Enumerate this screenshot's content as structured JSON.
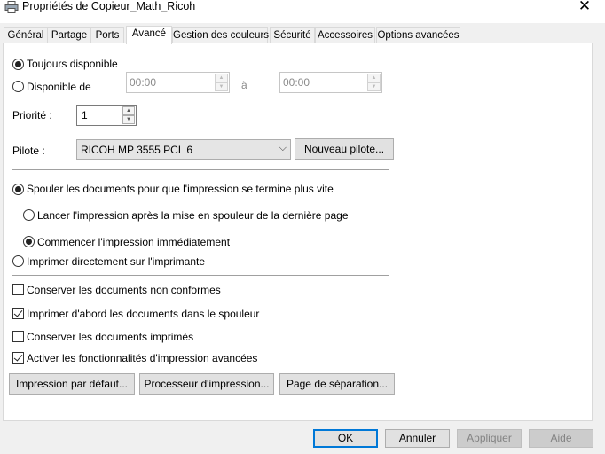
{
  "window": {
    "title": "Propriétés de Copieur_Math_Ricoh",
    "close_glyph": "✕"
  },
  "tabs": [
    {
      "label": "Général"
    },
    {
      "label": "Partage"
    },
    {
      "label": "Ports"
    },
    {
      "label": "Avancé",
      "active": true
    },
    {
      "label": "Gestion des couleurs"
    },
    {
      "label": "Sécurité"
    },
    {
      "label": "Accessoires"
    },
    {
      "label": "Options avancées"
    }
  ],
  "availability": {
    "always_label": "Toujours disponible",
    "always_checked": true,
    "from_label": "Disponible de",
    "from_time": "00:00",
    "to_label": "à",
    "to_time": "00:00"
  },
  "priority": {
    "label": "Priorité :",
    "value": "1"
  },
  "driver": {
    "label": "Pilote :",
    "selected": "RICOH MP 3555 PCL 6",
    "new_button": "Nouveau pilote..."
  },
  "spooling": {
    "spool_label": "Spouler les documents pour que l'impression se termine plus vite",
    "spool_checked": true,
    "after_last_page_label": "Lancer l'impression après la mise en spouleur de la dernière page",
    "after_last_page_checked": false,
    "immediately_label": "Commencer l'impression immédiatement",
    "immediately_checked": true,
    "direct_label": "Imprimer directement sur l'imprimante",
    "direct_checked": false
  },
  "options": [
    {
      "label": "Conserver les documents non conformes",
      "checked": false
    },
    {
      "label": "Imprimer d'abord les documents dans le spouleur",
      "checked": true
    },
    {
      "label": "Conserver les documents imprimés",
      "checked": false
    },
    {
      "label": "Activer les fonctionnalités d'impression avancées",
      "checked": true
    }
  ],
  "bottom_buttons": {
    "defaults": "Impression par défaut...",
    "processor": "Processeur d'impression...",
    "separator_page": "Page de séparation..."
  },
  "dialog_buttons": {
    "ok": "OK",
    "cancel": "Annuler",
    "apply": "Appliquer",
    "help": "Aide"
  },
  "colors": {
    "accent": "#0078d7",
    "panel": "#ffffff",
    "window": "#f0f0f0"
  },
  "icons": {
    "title": "printer-icon",
    "spin_up": "▲",
    "spin_down": "▼",
    "combo": "chevron-down-icon"
  }
}
